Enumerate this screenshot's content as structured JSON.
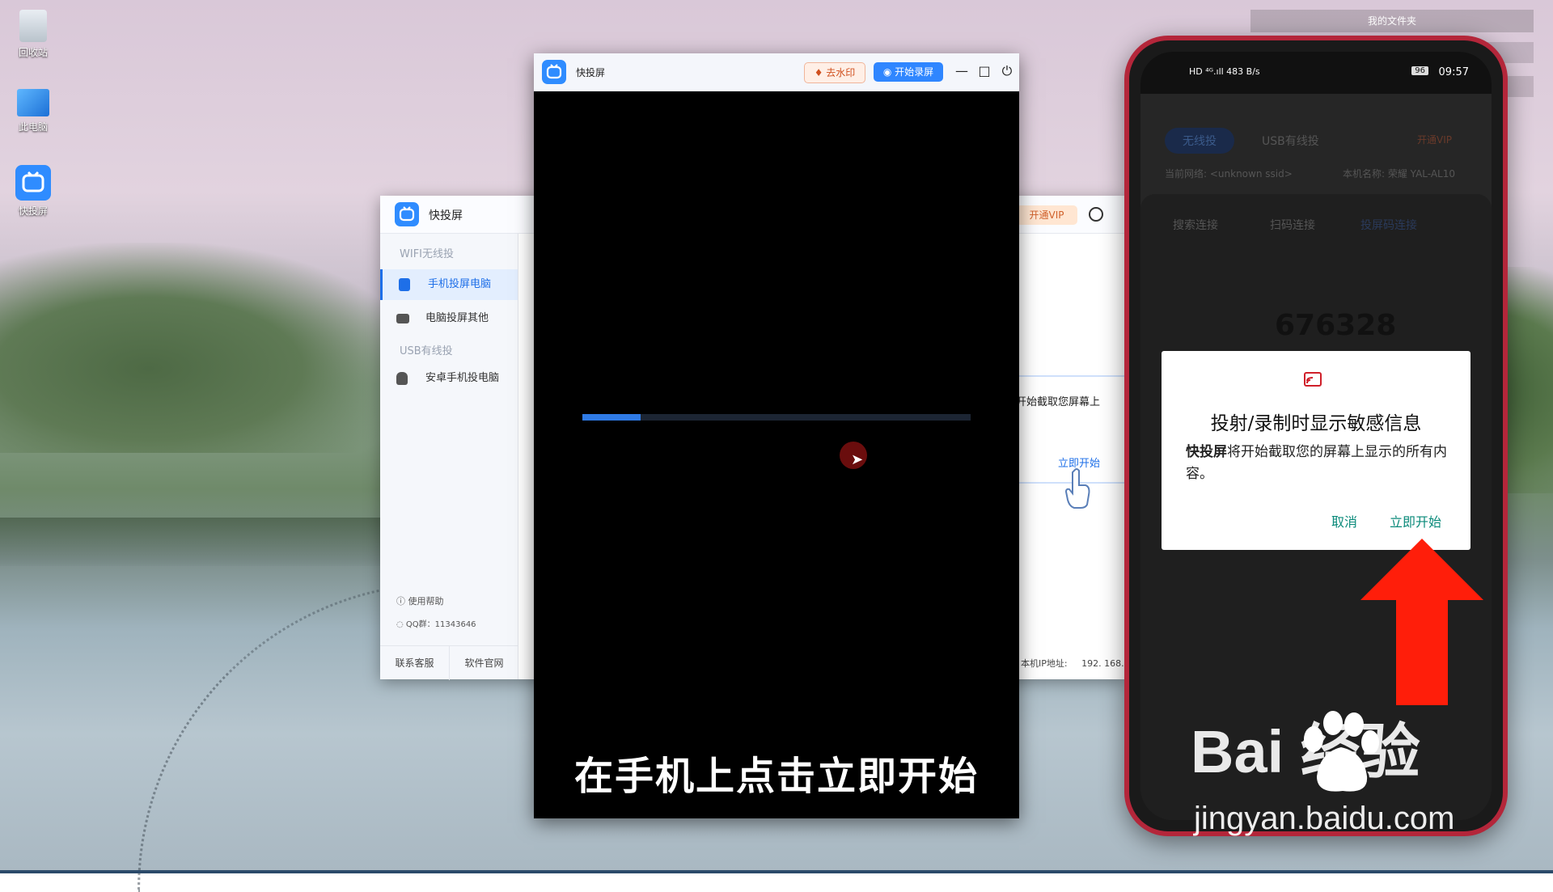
{
  "desktop": {
    "icons": [
      {
        "label": "回收站"
      },
      {
        "label": "此电脑"
      },
      {
        "label": "快投屏"
      }
    ],
    "top_folder": "我的文件夹"
  },
  "back_window": {
    "title": "快投屏",
    "vip_label": "开通VIP",
    "section_wifi": "WIFI无线投",
    "nav_phone_to_pc": "手机投屏电脑",
    "nav_pc_to_other": "电脑投屏其他",
    "section_usb": "USB有线投",
    "nav_android_usb": "安卓手机投电脑",
    "help": "使用帮助",
    "qq": "QQ群：11343646",
    "contact": "联系客服",
    "website": "软件官网",
    "right_text": "开始截取您屏幕上",
    "start_link": "立即开始",
    "ip_label": "本机IP地址:",
    "ip_value": "192. 168."
  },
  "front_window": {
    "title": "快投屏",
    "remove_watermark": "去水印",
    "start_recording": "开始录屏",
    "progress": 0.15,
    "caption": "在手机上点击立即开始"
  },
  "phone": {
    "status_left": "HD ⁴ᴳ.ıll  483 B/s",
    "battery": "96",
    "time": "09:57",
    "tab_wireless": "无线投",
    "tab_usb": "USB有线投",
    "vip": "开通VIP",
    "network": "当前网络: <unknown ssid>",
    "device_name": "本机名称: 荣耀 YAL-AL10",
    "sub_search": "搜索连接",
    "sub_scan": "扫码连接",
    "sub_code": "投屏码连接",
    "code": "676328",
    "dialog_title": "投射/录制时显示敏感信息",
    "dialog_app": "快投屏",
    "dialog_body": "将开始截取您的屏幕上显示的所有内容。",
    "cancel": "取消",
    "start_now": "立即开始"
  },
  "watermark": {
    "brand": "Bai  经验",
    "url": "jingyan.baidu.com"
  }
}
